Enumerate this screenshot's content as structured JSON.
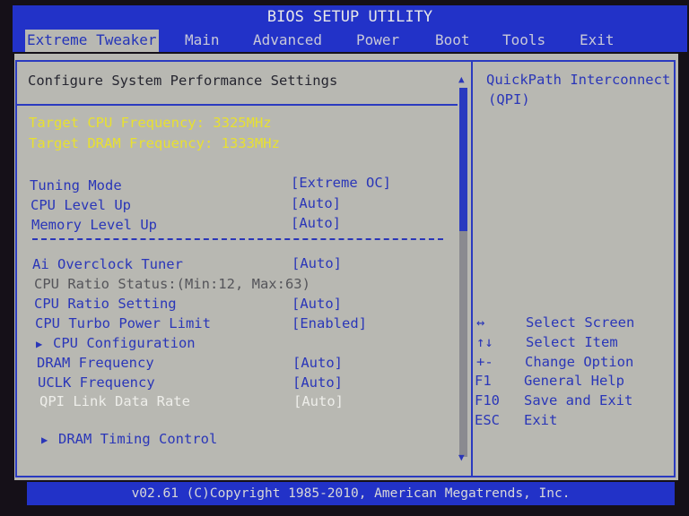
{
  "title": "BIOS SETUP UTILITY",
  "tabs": [
    {
      "label": "Extreme Tweaker",
      "active": true
    },
    {
      "label": "Main"
    },
    {
      "label": "Advanced"
    },
    {
      "label": "Power"
    },
    {
      "label": "Boot"
    },
    {
      "label": "Tools"
    },
    {
      "label": "Exit"
    }
  ],
  "section_title": "Configure System Performance Settings",
  "info": {
    "target_cpu": "Target CPU Frequency: 3325MHz",
    "target_dram": "Target DRAM Frequency: 1333MHz"
  },
  "settings": [
    {
      "label": "Tuning Mode",
      "value": "[Extreme OC]"
    },
    {
      "label": "CPU Level Up",
      "value": "[Auto]"
    },
    {
      "label": "Memory Level Up",
      "value": "[Auto]"
    },
    {
      "label": "Ai Overclock Tuner",
      "value": "[Auto]"
    },
    {
      "label": "CPU Ratio Status:(Min:12, Max:63)"
    },
    {
      "label": "CPU Ratio Setting",
      "value": "[Auto]"
    },
    {
      "label": "CPU Turbo Power Limit",
      "value": "[Enabled]"
    },
    {
      "label": "CPU Configuration",
      "submenu": true
    },
    {
      "label": "DRAM Frequency",
      "value": "[Auto]"
    },
    {
      "label": "UCLK Frequency",
      "value": "[Auto]"
    },
    {
      "label": "QPI Link Data Rate",
      "value": "[Auto]",
      "disabled": true
    },
    {
      "label": "DRAM Timing Control",
      "submenu": true
    }
  ],
  "help_text": "QuickPath Interconnect (QPI)",
  "help_line1": "QuickPath Interconnect",
  "help_line2": "(QPI)",
  "keys": [
    {
      "key": "↔",
      "action": "Select Screen"
    },
    {
      "key": "↑↓",
      "action": "Select Item"
    },
    {
      "key": "+-",
      "action": "Change Option"
    },
    {
      "key": "F1",
      "action": "General Help"
    },
    {
      "key": "F10",
      "action": "Save and Exit"
    },
    {
      "key": "ESC",
      "action": "Exit"
    }
  ],
  "footer": "v02.61 (C)Copyright 1985-2010, American Megatrends, Inc.",
  "submenu_marker": "▶",
  "scroll_up": "▲",
  "scroll_down": "▼",
  "colors": {
    "accent": "#2232c8",
    "panel": "#b8b8b2",
    "highlight": "#e8e030"
  }
}
